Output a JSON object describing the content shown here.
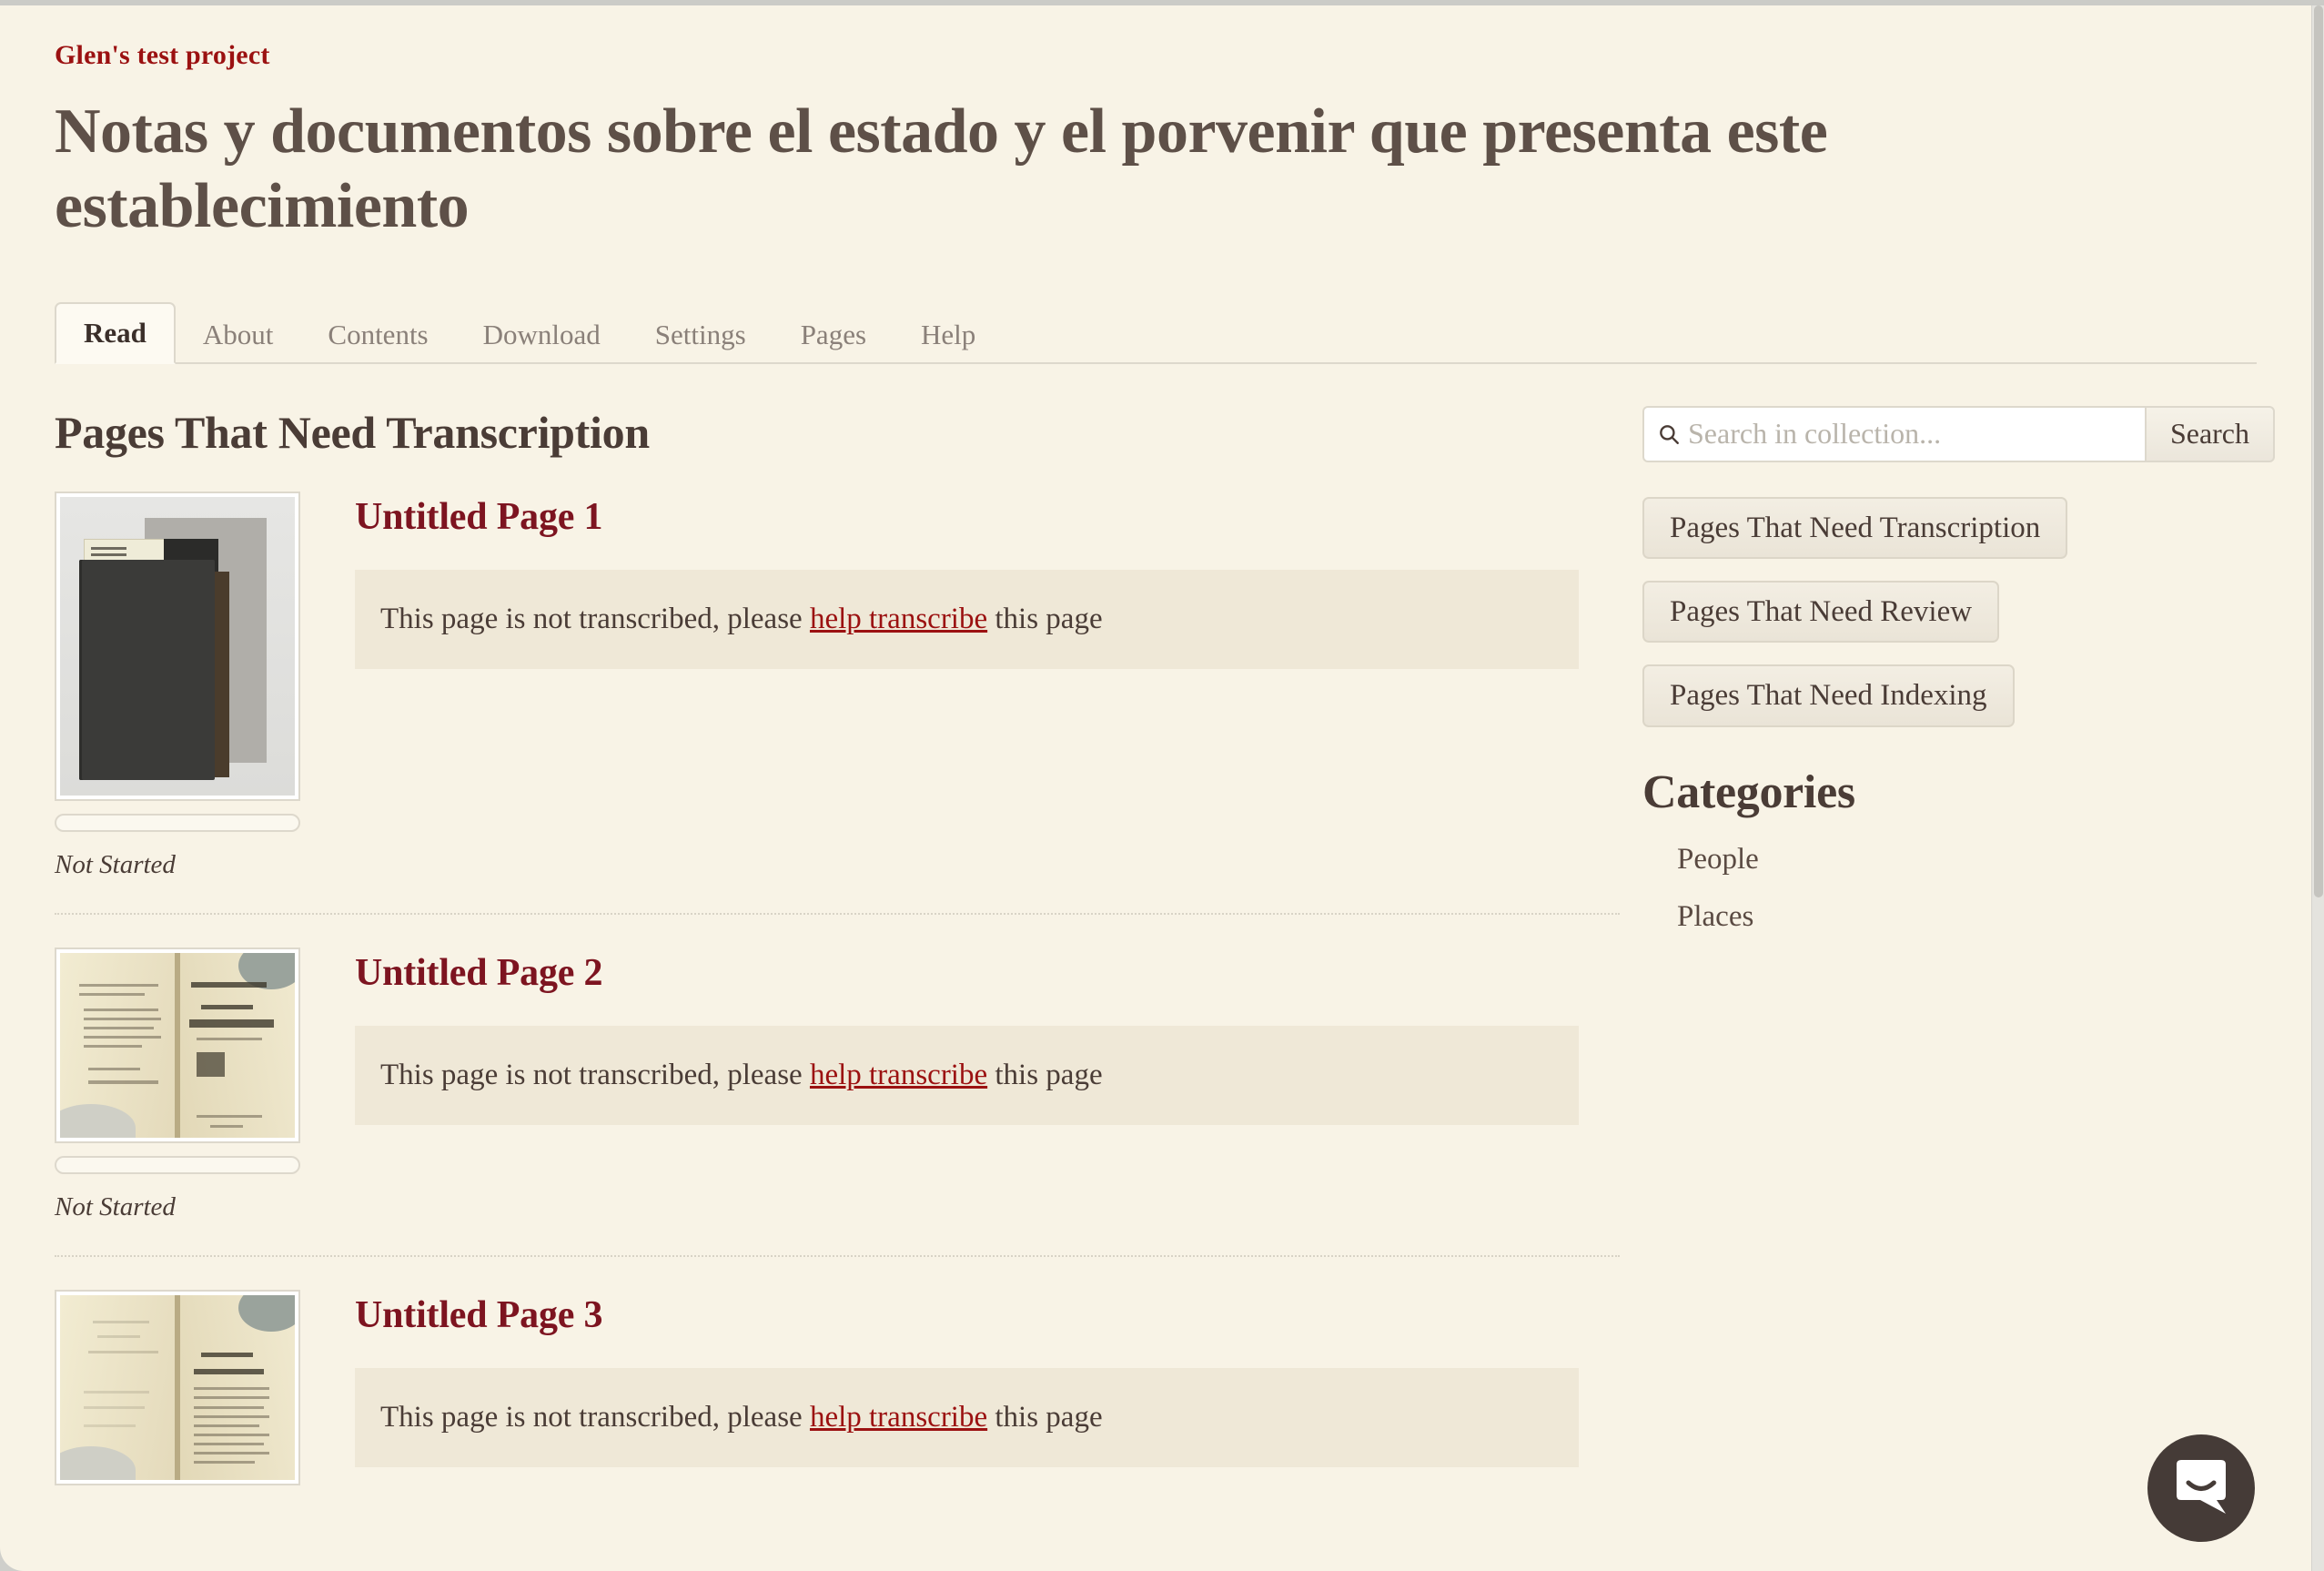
{
  "header": {
    "project_link": "Glen's test project",
    "title": "Notas y documentos sobre el estado y el porvenir que presenta este establecimiento"
  },
  "tabs": [
    {
      "label": "Read",
      "active": true
    },
    {
      "label": "About",
      "active": false
    },
    {
      "label": "Contents",
      "active": false
    },
    {
      "label": "Download",
      "active": false
    },
    {
      "label": "Settings",
      "active": false
    },
    {
      "label": "Pages",
      "active": false
    },
    {
      "label": "Help",
      "active": false
    }
  ],
  "main": {
    "section_heading": "Pages That Need Transcription",
    "entries": [
      {
        "title": "Untitled Page 1",
        "notice_prefix": "This page is not transcribed, please ",
        "notice_link": "help transcribe",
        "notice_suffix": " this page",
        "status": "Not Started",
        "thumb_kind": "book-cover-photo"
      },
      {
        "title": "Untitled Page 2",
        "notice_prefix": "This page is not transcribed, please ",
        "notice_link": "help transcribe",
        "notice_suffix": " this page",
        "status": "Not Started",
        "thumb_kind": "open-book-title-page"
      },
      {
        "title": "Untitled Page 3",
        "notice_prefix": "This page is not transcribed, please ",
        "notice_link": "help transcribe",
        "notice_suffix": " this page",
        "status": "",
        "thumb_kind": "open-book-text-page"
      }
    ]
  },
  "sidebar": {
    "search": {
      "placeholder": "Search in collection...",
      "value": "",
      "button_label": "Search",
      "icon": "search-icon"
    },
    "filters": [
      "Pages That Need Transcription",
      "Pages That Need Review",
      "Pages That Need Indexing"
    ],
    "categories_heading": "Categories",
    "categories": [
      "People",
      "Places"
    ]
  },
  "chat": {
    "icon": "chat-bubble-icon"
  },
  "colors": {
    "page_background": "#f8f3e6",
    "accent_red": "#9b1111",
    "title_link_red": "#7d1420",
    "heading_brown": "#4a3c36",
    "notice_background": "#efe8d7",
    "chat_bubble": "#453b37"
  }
}
